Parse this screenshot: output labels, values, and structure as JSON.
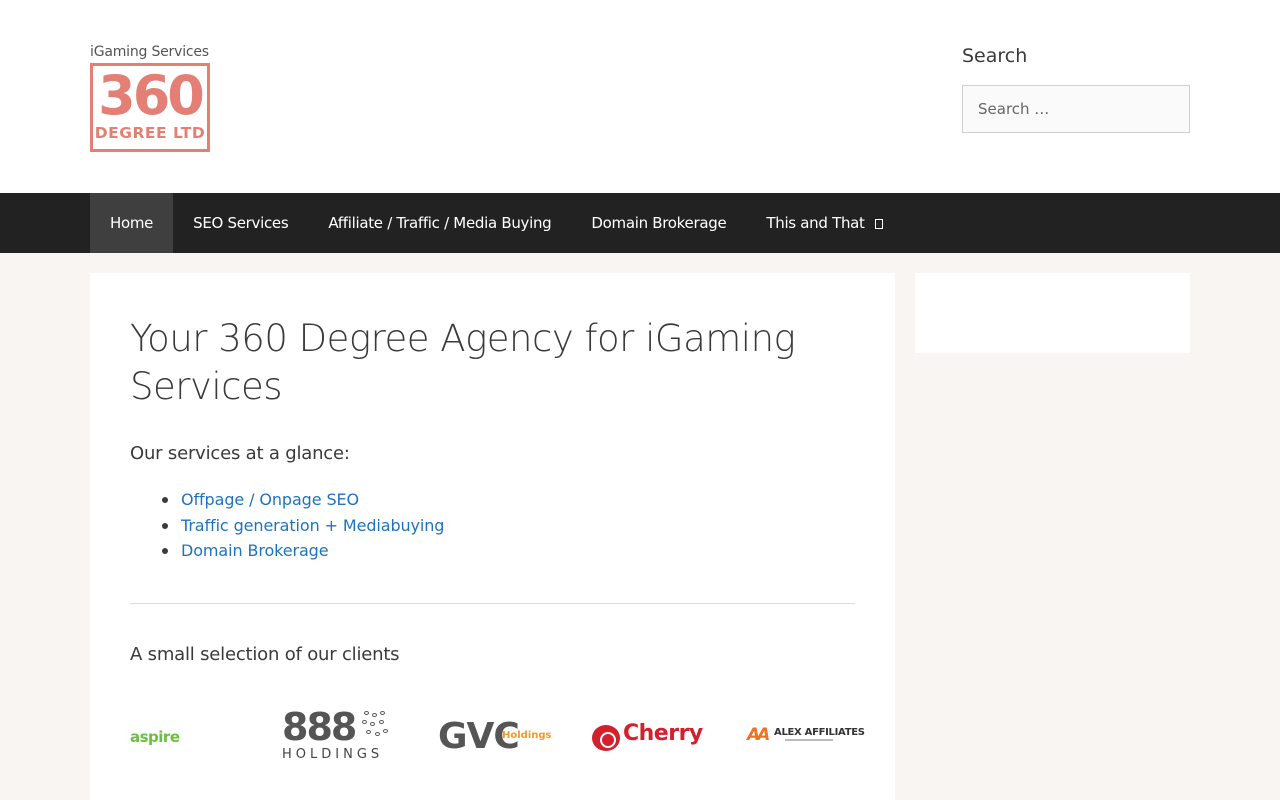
{
  "header": {
    "tagline": "iGaming Services",
    "logo_big": "360",
    "logo_small": "DEGREE LTD",
    "search_title": "Search",
    "search_placeholder": "Search …",
    "brand_color": "#e37f74"
  },
  "nav": {
    "items": [
      {
        "label": "Home",
        "active": true
      },
      {
        "label": "SEO Services"
      },
      {
        "label": "Affiliate / Traffic / Media Buying"
      },
      {
        "label": "Domain Brokerage"
      },
      {
        "label": "This and That",
        "has_dropdown": true
      }
    ]
  },
  "main": {
    "title": "Your 360 Degree Agency for iGaming Services",
    "intro": "Our services at a glance:",
    "services": [
      "Offpage / Onpage SEO",
      "Traffic generation + Mediabuying",
      "Domain Brokerage"
    ],
    "clients_title": "A small selection of our clients",
    "clients": {
      "aspire": "aspire",
      "h888_number": "888",
      "h888_text": "HOLDINGS",
      "gvc_main": "GVC",
      "gvc_sub": "Holdings",
      "cherry": "Cherry",
      "alex": "ALEX AFFILIATES",
      "alex_mark": "AA"
    }
  }
}
